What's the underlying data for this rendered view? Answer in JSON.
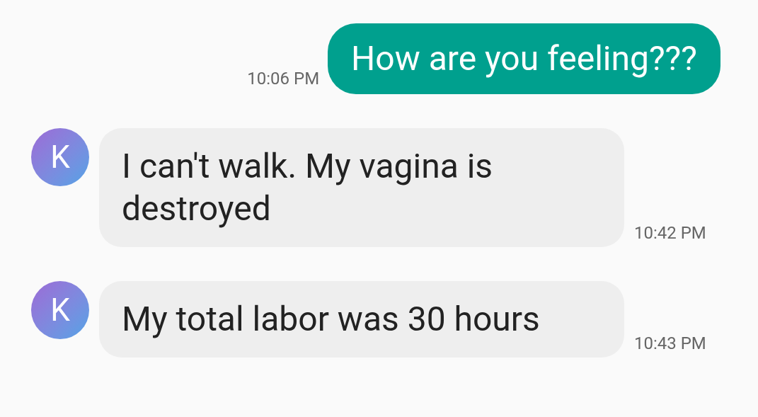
{
  "messages": [
    {
      "kind": "outgoing",
      "text": "How are you feeling???",
      "time": "10:06 PM"
    },
    {
      "kind": "incoming",
      "avatar": "K",
      "text": "I can't walk. My vagina is destroyed",
      "time": "10:42 PM"
    },
    {
      "kind": "incoming",
      "avatar": "K",
      "text": "My total labor was 30 hours",
      "time": "10:43 PM"
    }
  ]
}
